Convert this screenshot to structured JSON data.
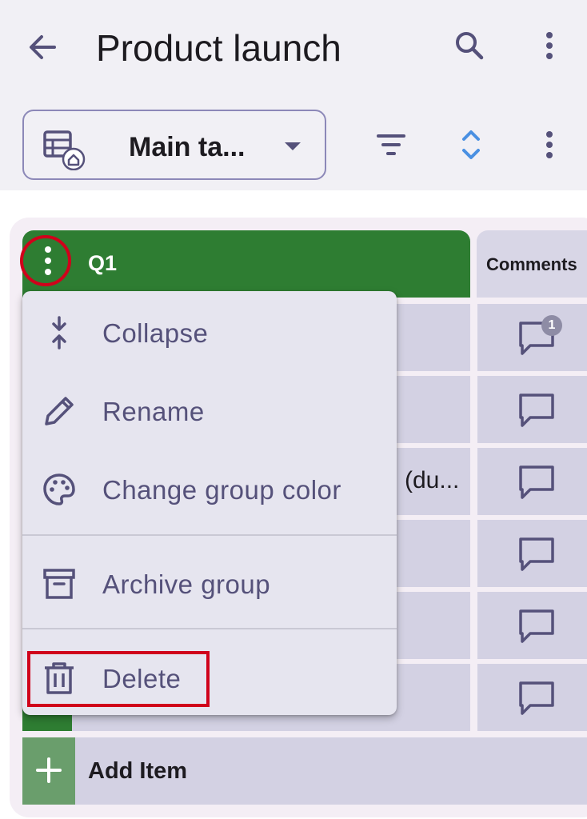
{
  "header": {
    "title": "Product launch",
    "icons": {
      "back": "arrow-left-icon",
      "search": "search-icon",
      "more": "more-vertical-icon"
    }
  },
  "view_selector": {
    "label": "Main ta...",
    "icons": {
      "view": "table-home-icon",
      "dropdown": "caret-down-icon"
    }
  },
  "view_actions": {
    "icons": {
      "filter": "filter-icon",
      "sort": "sort-icon",
      "more": "more-vertical-icon"
    }
  },
  "group": {
    "name": "Q1",
    "color": "#2e7d32"
  },
  "columns": {
    "comments_header": "Comments"
  },
  "rows": [
    {
      "text": "",
      "comment_badge": "1"
    },
    {
      "text": "",
      "comment_badge": ""
    },
    {
      "text": "(du...",
      "comment_badge": ""
    },
    {
      "text": "",
      "comment_badge": ""
    },
    {
      "text": "",
      "comment_badge": ""
    },
    {
      "text": "",
      "comment_badge": ""
    }
  ],
  "add_item": {
    "label": "Add Item"
  },
  "context_menu": {
    "items": [
      {
        "label": "Collapse",
        "icon": "collapse-icon"
      },
      {
        "label": "Rename",
        "icon": "pencil-icon"
      },
      {
        "label": "Change group color",
        "icon": "palette-icon"
      },
      {
        "label": "Archive group",
        "icon": "archive-icon"
      },
      {
        "label": "Delete",
        "icon": "trash-icon"
      }
    ]
  },
  "colors": {
    "accent": "#2e7d32",
    "highlight": "#d0021b",
    "menu_text": "#55517a",
    "sort_icon": "#4a90e2"
  }
}
